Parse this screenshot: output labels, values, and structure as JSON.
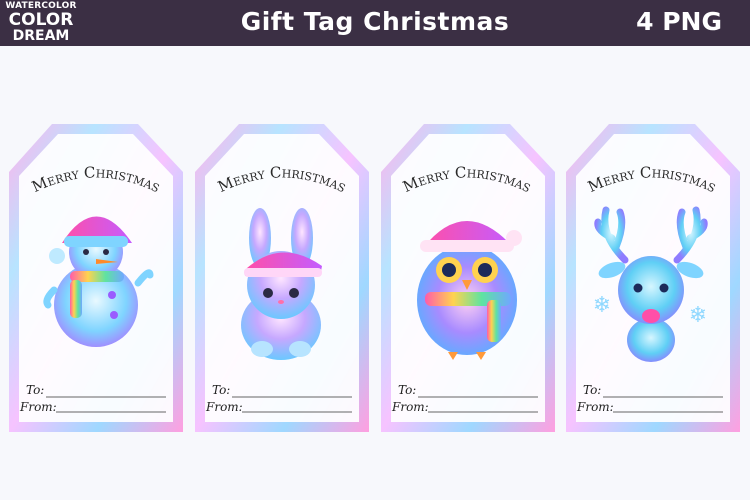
{
  "header": {
    "logo": {
      "line1": "WATERCOLOR",
      "line2": "COLOR",
      "line3": "DREAM"
    },
    "title": "Gift Tag Christmas",
    "count_label": "4 PNG"
  },
  "tags": [
    {
      "greeting": "Merry Christmas",
      "to_label": "To:",
      "from_label": "From:",
      "character": "snowman"
    },
    {
      "greeting": "Merry Christmas",
      "to_label": "To:",
      "from_label": "From:",
      "character": "bunny"
    },
    {
      "greeting": "Merry Christmas",
      "to_label": "To:",
      "from_label": "From:",
      "character": "owl"
    },
    {
      "greeting": "Merry Christmas",
      "to_label": "To:",
      "from_label": "From:",
      "character": "reindeer"
    }
  ],
  "colors": {
    "header_bg": "#3b2f44",
    "background": "#f7f8fc"
  }
}
